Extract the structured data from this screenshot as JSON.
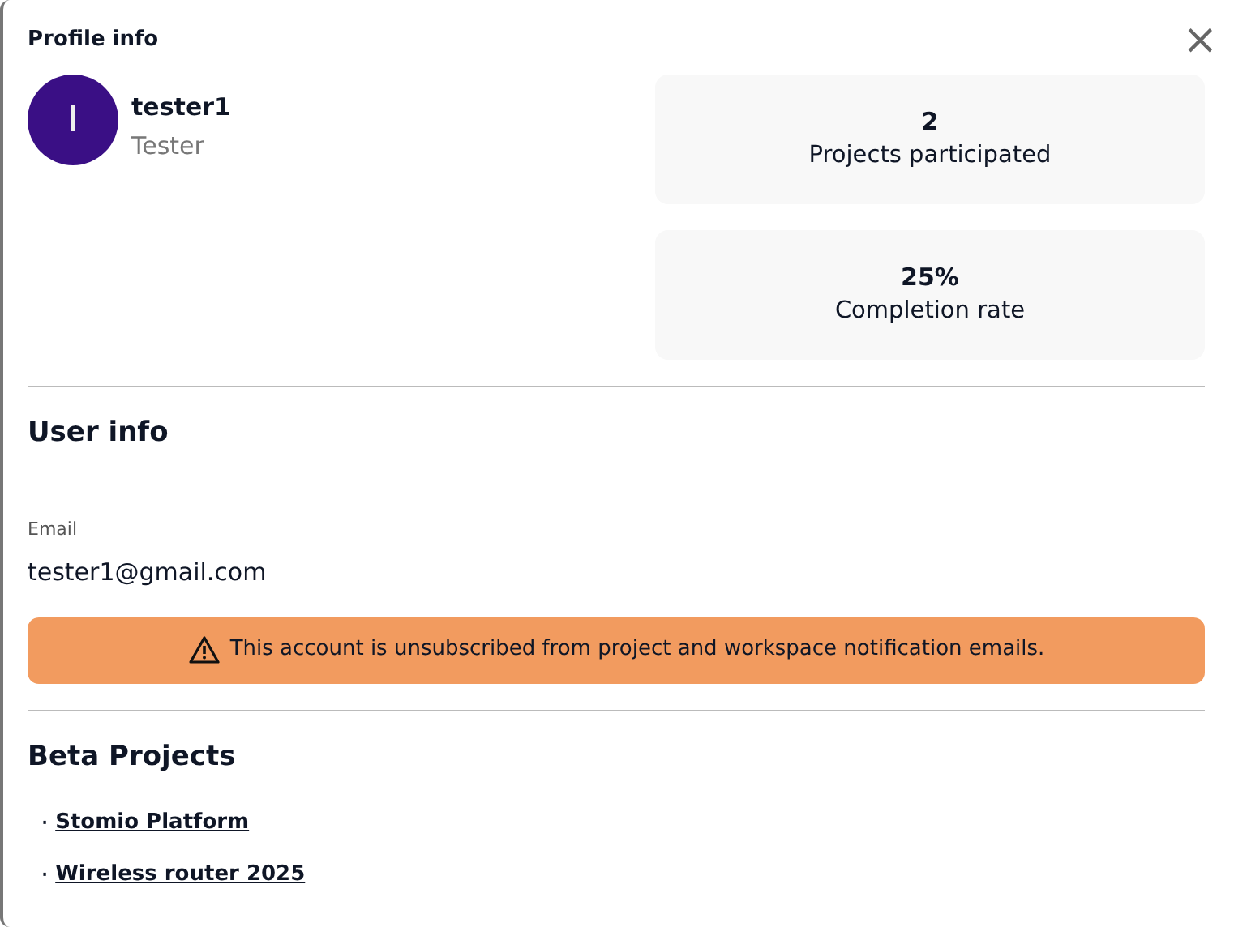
{
  "dialog": {
    "title": "Profile info",
    "close": "×"
  },
  "profile": {
    "initial": "I",
    "name": "tester1",
    "role": "Tester"
  },
  "stats": [
    {
      "value": "2",
      "label": "Projects participated"
    },
    {
      "value": "25%",
      "label": "Completion rate"
    }
  ],
  "user_info": {
    "heading": "User info",
    "email_label": "Email",
    "email": "tester1@gmail.com"
  },
  "alert": {
    "text": "This account is unsubscribed from project and workspace notification emails."
  },
  "beta_projects": {
    "heading": "Beta Projects",
    "items": [
      {
        "bullet": "·",
        "name": "Stomio Platform"
      },
      {
        "bullet": "·",
        "name": "Wireless router 2025"
      }
    ]
  }
}
